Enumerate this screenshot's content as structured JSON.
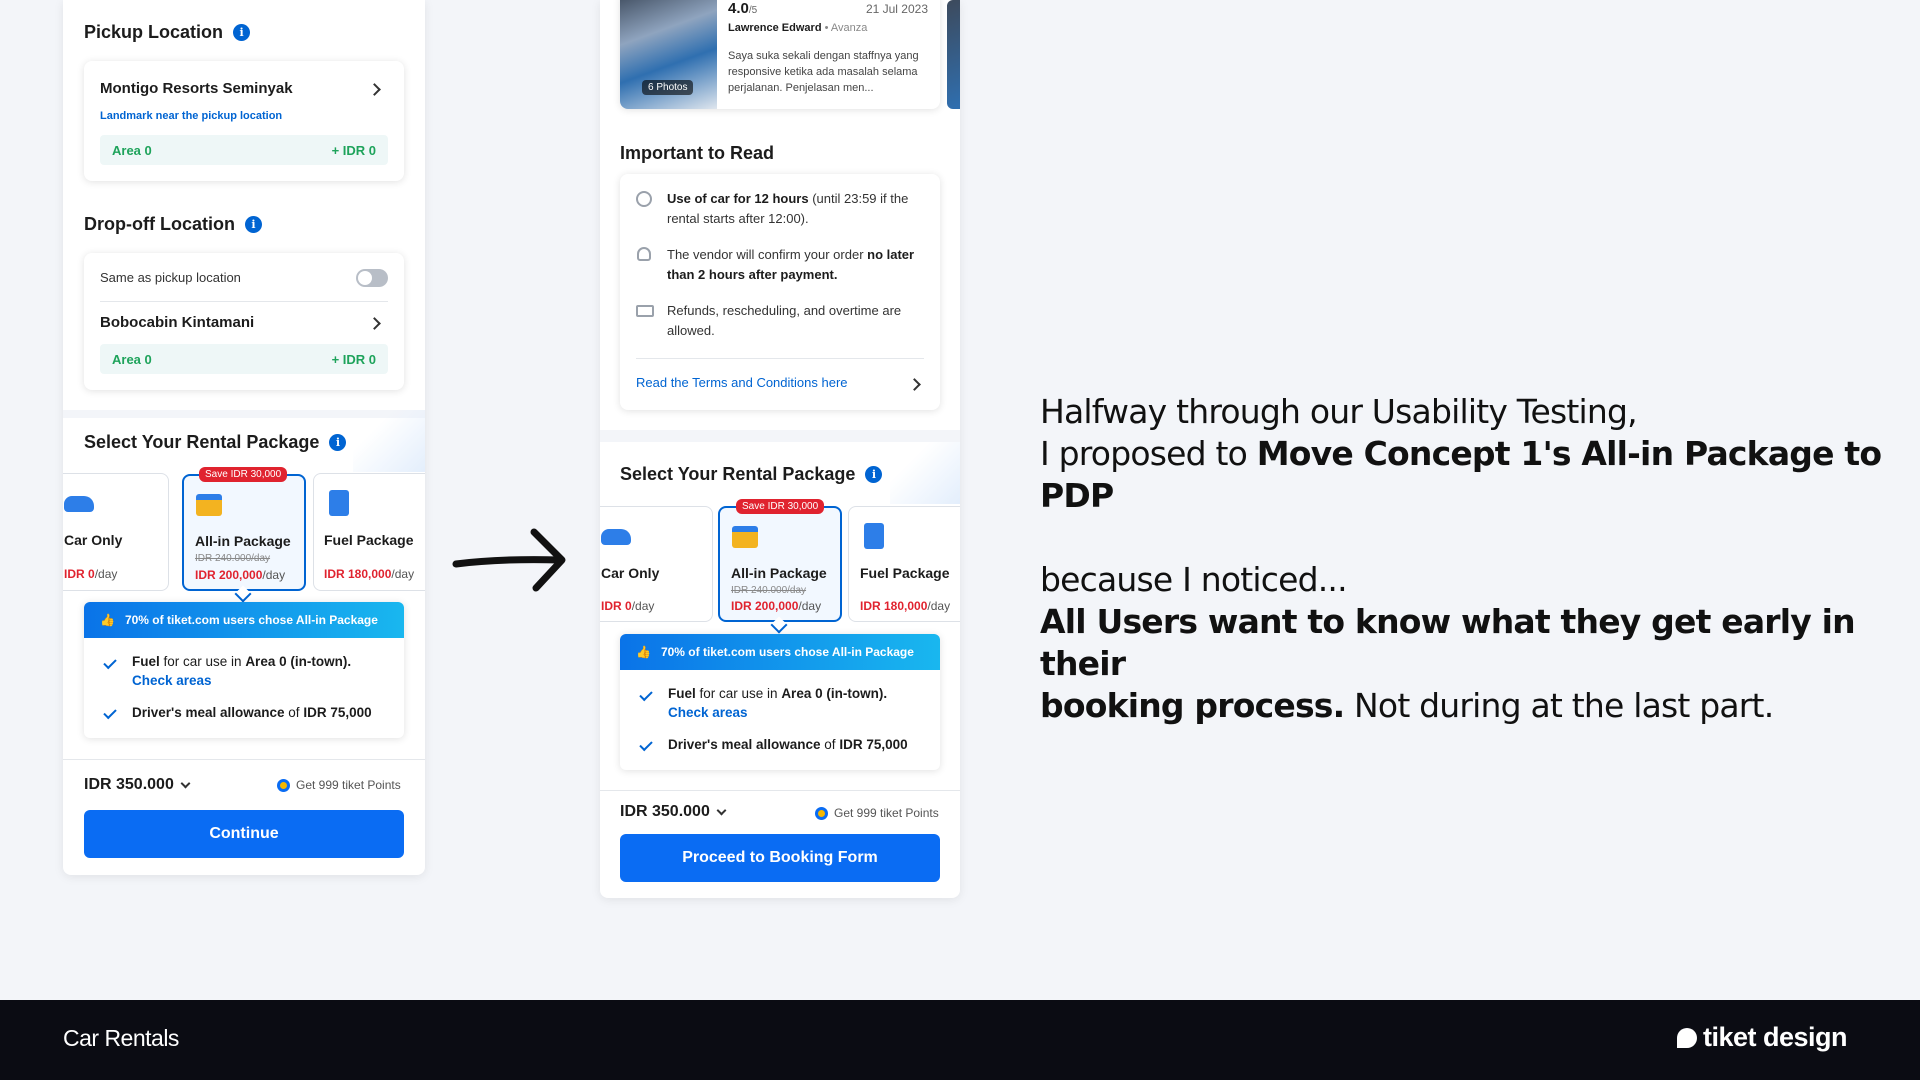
{
  "left": {
    "pickup": {
      "title": "Pickup Location",
      "place": "Montigo Resorts Seminyak",
      "landmark": "Landmark near the pickup location",
      "area": "Area 0",
      "area_price": "+ IDR 0"
    },
    "dropoff": {
      "title": "Drop-off Location",
      "same_as_label": "Same as pickup location",
      "place": "Bobocabin Kintamani",
      "area": "Area 0",
      "area_price": "+ IDR 0"
    },
    "package": {
      "title": "Select Your Rental Package",
      "car_only": {
        "name": "Car Only",
        "price": "IDR 0",
        "unit": "/day"
      },
      "all_in": {
        "badge": "Save IDR 30,000",
        "name": "All-in Package",
        "strike": "IDR 240.000/day",
        "price": "IDR 200,000",
        "unit": "/day"
      },
      "fuel": {
        "name": "Fuel Package",
        "price": "IDR 180,000",
        "unit": "/day"
      }
    },
    "promo": {
      "header": "70% of tiket.com users chose All-in Package",
      "f1_bold": "Fuel",
      "f1_mid": " for car use in ",
      "f1_bold2": "Area 0 (in-town).",
      "f1_link": "Check areas",
      "f2_bold": "Driver's meal allowance",
      "f2_mid": " of ",
      "f2_bold2": "IDR 75,000"
    },
    "total": "IDR 350.000",
    "points": "Get 999 tiket Points",
    "cta": "Continue"
  },
  "right": {
    "review": {
      "rating": "4.0",
      "rating_scale": "/5",
      "date": "21 Jul 2023",
      "author": "Lawrence Edward",
      "car": "Avanza",
      "text": "Saya suka sekali dengan staffnya yang responsive ketika ada masalah selama perjalanan. Penjelasan men...",
      "photos": "6 Photos"
    },
    "important": {
      "title": "Important to Read",
      "i1_bold": "Use of car for 12 hours",
      "i1_rest": " (until 23:59 if the rental starts after 12:00).",
      "i2_pre": "The vendor will confirm your order ",
      "i2_bold": "no later than 2 hours after payment.",
      "i3": "Refunds, rescheduling, and overtime are allowed.",
      "terms_link": "Read the Terms and Conditions here"
    },
    "package": {
      "title": "Select Your Rental Package",
      "car_only": {
        "name": "Car Only",
        "price": "IDR 0",
        "unit": "/day"
      },
      "all_in": {
        "badge": "Save IDR 30,000",
        "name": "All-in Package",
        "strike": "IDR 240.000/day",
        "price": "IDR 200,000",
        "unit": "/day"
      },
      "fuel": {
        "name": "Fuel Package",
        "price": "IDR 180,000",
        "unit": "/day"
      }
    },
    "promo": {
      "header": "70% of tiket.com users chose All-in Package",
      "f1_bold": "Fuel",
      "f1_mid": " for car use in ",
      "f1_bold2": "Area 0 (in-town).",
      "f1_link": "Check areas",
      "f2_bold": "Driver's meal allowance",
      "f2_mid": " of ",
      "f2_bold2": "IDR 75,000"
    },
    "total": "IDR 350.000",
    "points": "Get 999 tiket Points",
    "cta": "Proceed to Booking Form"
  },
  "headline": {
    "l1": "Halfway through our Usability Testing,",
    "l2_pre": "I proposed to ",
    "l2_bold": "Move Concept 1's All-in Package to PDP",
    "l3": "because I noticed...",
    "l4_bold": "All Users want to know what they get early in their",
    "l5_bold": "booking process.",
    "l5_rest": " Not during at the last part."
  },
  "footer": {
    "section": "Car Rentals",
    "brand": "tiket design"
  },
  "colors": {
    "primary": "#0064d2",
    "danger": "#e0232f",
    "success": "#1ea35b",
    "footer": "#0b0c13"
  }
}
